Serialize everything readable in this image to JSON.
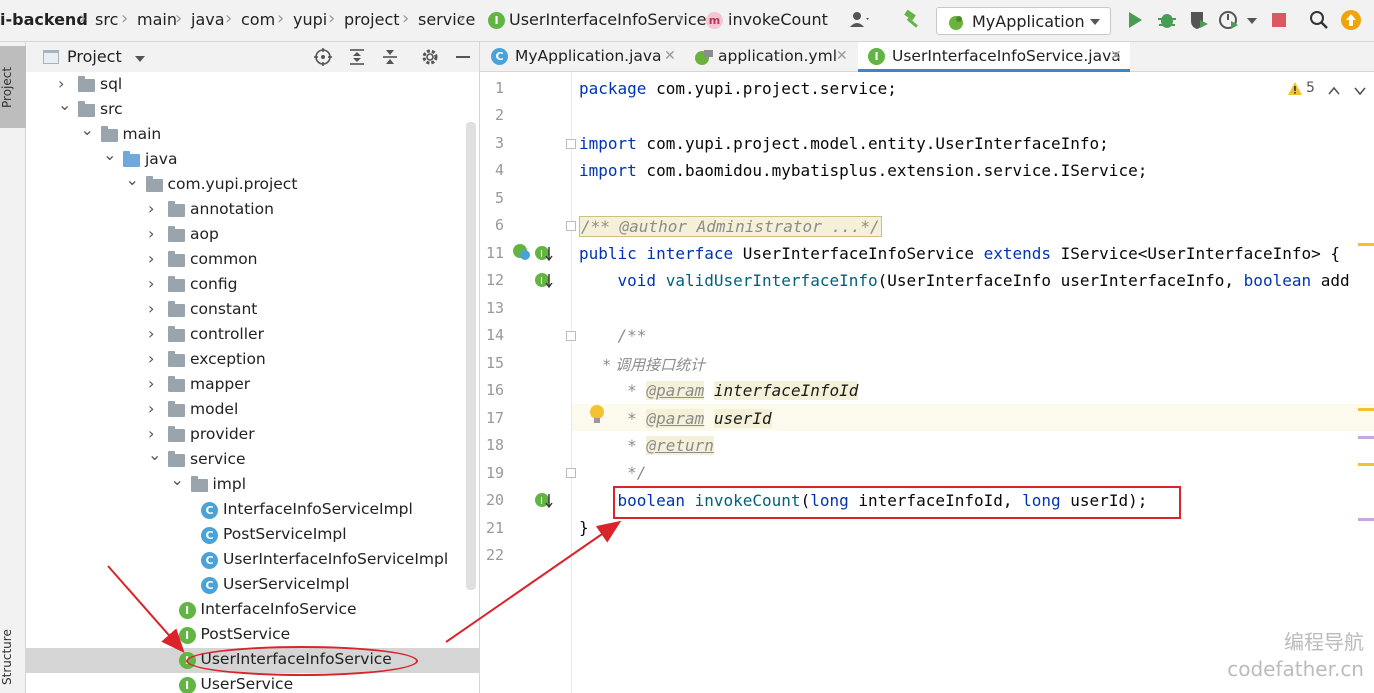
{
  "breadcrumbs": [
    "i-backend",
    "src",
    "main",
    "java",
    "com",
    "yupi",
    "project",
    "service",
    "UserInterfaceInfoService",
    "invokeCount"
  ],
  "run_config": "MyApplication",
  "left_strip": {
    "project_tab": "Project",
    "structure_tab": "Structure"
  },
  "project_panel": {
    "title": "Project",
    "tree": [
      {
        "label": "sql",
        "type": "folder",
        "depth": 0,
        "arrow": "›"
      },
      {
        "label": "src",
        "type": "folder",
        "depth": 0,
        "arrow": "⌄"
      },
      {
        "label": "main",
        "type": "folder",
        "depth": 1,
        "arrow": "⌄"
      },
      {
        "label": "java",
        "type": "folder-blue",
        "depth": 2,
        "arrow": "⌄"
      },
      {
        "label": "com.yupi.project",
        "type": "folder",
        "depth": 3,
        "arrow": "⌄"
      },
      {
        "label": "annotation",
        "type": "folder",
        "depth": 4,
        "arrow": "›"
      },
      {
        "label": "aop",
        "type": "folder",
        "depth": 4,
        "arrow": "›"
      },
      {
        "label": "common",
        "type": "folder",
        "depth": 4,
        "arrow": "›"
      },
      {
        "label": "config",
        "type": "folder",
        "depth": 4,
        "arrow": "›"
      },
      {
        "label": "constant",
        "type": "folder",
        "depth": 4,
        "arrow": "›"
      },
      {
        "label": "controller",
        "type": "folder",
        "depth": 4,
        "arrow": "›"
      },
      {
        "label": "exception",
        "type": "folder",
        "depth": 4,
        "arrow": "›"
      },
      {
        "label": "mapper",
        "type": "folder",
        "depth": 4,
        "arrow": "›"
      },
      {
        "label": "model",
        "type": "folder",
        "depth": 4,
        "arrow": "›"
      },
      {
        "label": "provider",
        "type": "folder",
        "depth": 4,
        "arrow": "›"
      },
      {
        "label": "service",
        "type": "folder",
        "depth": 4,
        "arrow": "⌄"
      },
      {
        "label": "impl",
        "type": "folder",
        "depth": 5,
        "arrow": "⌄"
      },
      {
        "label": "InterfaceInfoServiceImpl",
        "type": "class",
        "depth": 6,
        "arrow": ""
      },
      {
        "label": "PostServiceImpl",
        "type": "class",
        "depth": 6,
        "arrow": ""
      },
      {
        "label": "UserInterfaceInfoServiceImpl",
        "type": "class",
        "depth": 6,
        "arrow": ""
      },
      {
        "label": "UserServiceImpl",
        "type": "class",
        "depth": 6,
        "arrow": ""
      },
      {
        "label": "InterfaceInfoService",
        "type": "interface",
        "depth": 5,
        "arrow": ""
      },
      {
        "label": "PostService",
        "type": "interface",
        "depth": 5,
        "arrow": ""
      },
      {
        "label": "UserInterfaceInfoService",
        "type": "interface",
        "depth": 5,
        "arrow": "",
        "selected": true
      },
      {
        "label": "UserService",
        "type": "interface",
        "depth": 5,
        "arrow": ""
      }
    ]
  },
  "tabs": [
    {
      "label": "MyApplication.java",
      "icon": "class-c-icon"
    },
    {
      "label": "application.yml",
      "icon": "yml-icon"
    },
    {
      "label": "UserInterfaceInfoService.java",
      "icon": "interface-i-icon",
      "active": true
    }
  ],
  "warnings_count": "5",
  "line_numbers": [
    "1",
    "2",
    "3",
    "4",
    "5",
    "6",
    "11",
    "12",
    "13",
    "14",
    "15",
    "16",
    "17",
    "18",
    "19",
    "20",
    "21",
    "22"
  ],
  "code": {
    "l1_kw": "package",
    "l1_rest": " com.yupi.project.service;",
    "l3_kw": "import",
    "l3_rest": " com.yupi.project.model.entity.UserInterfaceInfo;",
    "l4_kw": "import",
    "l4_rest": " com.baomidou.mybatisplus.extension.service.IService;",
    "l6": "/** @author Administrator ...*/",
    "l11_kw1": "public",
    "l11_kw2": " interface",
    "l11_name": " UserInterfaceInfoService ",
    "l11_kw3": "extends",
    "l11_rest": " IService<UserInterfaceInfo> {",
    "l12_kw": "    void",
    "l12_fn": " validUserInterfaceInfo",
    "l12_rest": "(UserInterfaceInfo userInterfaceInfo, ",
    "l12_kw2": "boolean",
    "l12_tail": " add",
    "l14": "    /**",
    "l15": "     * 调用接口统计",
    "l16_pre": "     * ",
    "l16_tag": "@param",
    "l16_sp": " ",
    "l16_param": "interfaceInfoId",
    "l17_pre": "     * ",
    "l17_tag": "@param",
    "l17_sp": " ",
    "l17_param": "userId",
    "l18_pre": "     * ",
    "l18_tag": "@return",
    "l19": "     */",
    "l20_kw": "    boolean",
    "l20_fn": " invokeCount",
    "l20_p1": "(",
    "l20_kw2": "long",
    "l20_p2": " interfaceInfoId, ",
    "l20_kw3": "long",
    "l20_p3": " userId);",
    "l21": "}"
  },
  "watermark": {
    "line1": "编程导航",
    "line2": "codefather.cn"
  },
  "colors": {
    "annotation": "#d8242a",
    "accent": "#4083c9"
  }
}
